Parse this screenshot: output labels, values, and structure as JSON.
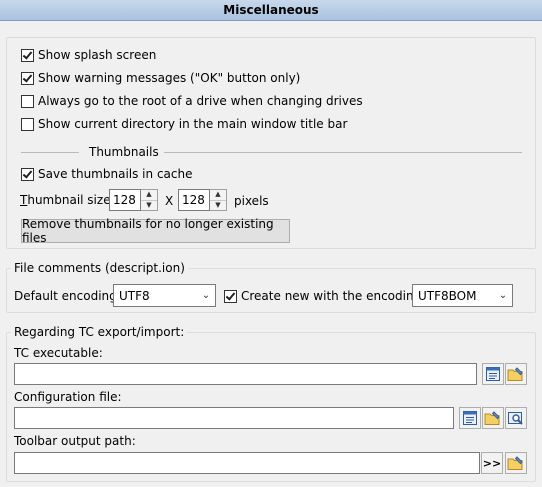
{
  "header": {
    "title": "Miscellaneous"
  },
  "general": {
    "checkboxes": [
      {
        "label": "Show splash screen",
        "checked": true
      },
      {
        "label": "Show warning messages (\"OK\" button only)",
        "checked": true
      },
      {
        "label": "Always go to the root of a drive when changing drives",
        "checked": false
      },
      {
        "label": "Show current directory in the main window title bar",
        "checked": false
      }
    ]
  },
  "thumbnails": {
    "heading": "Thumbnails",
    "save_label": "Save thumbnails in cache",
    "save_checked": true,
    "size_label_accel": "T",
    "size_label_rest": "humbnail size:",
    "width": "128",
    "x_label": "X",
    "height": "128",
    "unit": "pixels",
    "remove_button": "Remove thumbnails for no longer existing files"
  },
  "file_comments": {
    "legend": "File comments (descript.ion)",
    "encoding_label": "Default encoding:",
    "encoding_value": "UTF8",
    "create_new_label": "Create new with the encoding:",
    "create_new_checked": true,
    "create_new_value": "UTF8BOM"
  },
  "export": {
    "legend": "Regarding TC export/import:",
    "tc_exe_label": "TC executable:",
    "tc_exe_value": "",
    "config_label": "Configuration file:",
    "config_value": "",
    "toolbar_label": "Toolbar output path:",
    "toolbar_value": "",
    "arrows_button": ">>"
  },
  "icons": [
    "list-view-icon",
    "folder-edit-icon",
    "folder-search-icon"
  ]
}
